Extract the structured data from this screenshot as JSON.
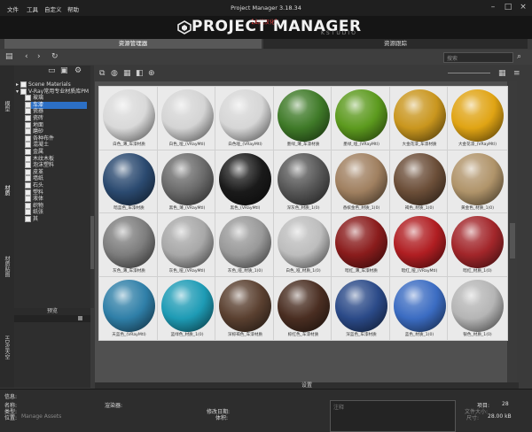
{
  "window": {
    "title": "Project Manager 3.18.34",
    "menu": [
      "文件",
      "工具",
      "自定义",
      "帮助"
    ]
  },
  "banner": {
    "tagline": "【曲线汉化】",
    "logo_text": "PROJECT MANAGER",
    "logo_sub": "KSTUDIO"
  },
  "tabs": [
    "资源管理器",
    "资源跟踪"
  ],
  "search": {
    "placeholder": "搜索"
  },
  "side_tabs": [
    "模型",
    "材质",
    "材质贴图",
    "HDRI天空"
  ],
  "tree": {
    "items": [
      {
        "label": "Scene Materials",
        "indent": 0,
        "expander": "▸",
        "selected": false
      },
      {
        "label": "V-Ray常用专业材质库PM",
        "indent": 0,
        "expander": "▾",
        "selected": false
      },
      {
        "label": "玻璃",
        "indent": 1,
        "expander": "",
        "selected": false
      },
      {
        "label": "车漆",
        "indent": 1,
        "expander": "",
        "selected": true
      },
      {
        "label": "瓷器",
        "indent": 1,
        "expander": "",
        "selected": false
      },
      {
        "label": "瓷砖",
        "indent": 1,
        "expander": "",
        "selected": false
      },
      {
        "label": "地面",
        "indent": 1,
        "expander": "",
        "selected": false
      },
      {
        "label": "磨砂",
        "indent": 1,
        "expander": "",
        "selected": false
      },
      {
        "label": "各种布件",
        "indent": 1,
        "expander": "",
        "selected": false
      },
      {
        "label": "混凝土",
        "indent": 1,
        "expander": "",
        "selected": false
      },
      {
        "label": "金属",
        "indent": 1,
        "expander": "",
        "selected": false
      },
      {
        "label": "木纹木板",
        "indent": 1,
        "expander": "",
        "selected": false
      },
      {
        "label": "泡沫塑料",
        "indent": 1,
        "expander": "",
        "selected": false
      },
      {
        "label": "皮革",
        "indent": 1,
        "expander": "",
        "selected": false
      },
      {
        "label": "墙纸",
        "indent": 1,
        "expander": "",
        "selected": false
      },
      {
        "label": "石头",
        "indent": 1,
        "expander": "",
        "selected": false
      },
      {
        "label": "塑料",
        "indent": 1,
        "expander": "",
        "selected": false
      },
      {
        "label": "液体",
        "indent": 1,
        "expander": "",
        "selected": false
      },
      {
        "label": "织物",
        "indent": 1,
        "expander": "",
        "selected": false
      },
      {
        "label": "纸张",
        "indent": 1,
        "expander": "",
        "selected": false
      },
      {
        "label": "其",
        "indent": 1,
        "expander": "",
        "selected": false
      }
    ]
  },
  "preview": {
    "label": "预览"
  },
  "materials": [
    {
      "caption": "白色_薄_车漆材质",
      "color": "#d9d9d9"
    },
    {
      "caption": "白色_哑_(VRayMtl)",
      "color": "#d4d4d4"
    },
    {
      "caption": "白色哑_(VRayMtl)",
      "color": "#d6d6d6"
    },
    {
      "caption": "墨绿_薄_车漆材质",
      "color": "#3f7a28"
    },
    {
      "caption": "墨绿_哑_(VRayMtl)",
      "color": "#5c9a1e"
    },
    {
      "caption": "大金花漆_车漆材质",
      "color": "#c9961e"
    },
    {
      "caption": "大金花漆_(VRayMtl)",
      "color": "#e0a414"
    },
    {
      "caption": "暗蓝色_车漆材质",
      "color": "#2b4a70"
    },
    {
      "caption": "黑色_薄_(VRayMtl)",
      "color": "#6a6a6a"
    },
    {
      "caption": "黑色_(VRayMtl)",
      "color": "#1a1a1a"
    },
    {
      "caption": "深灰色_材质_1(0)",
      "color": "#565656"
    },
    {
      "caption": "香槟金色_材质_1(0)",
      "color": "#a08060"
    },
    {
      "caption": "褐色_材质_1(0)",
      "color": "#6b4e38"
    },
    {
      "caption": "黄金色_材质_1(0)",
      "color": "#b0946a"
    },
    {
      "caption": "灰色_薄_车漆材质",
      "color": "#7d7d7d"
    },
    {
      "caption": "灰色_哑_(VRayMtl)",
      "color": "#a8a8a8"
    },
    {
      "caption": "灰色_哑_材质_1(0)",
      "color": "#999999"
    },
    {
      "caption": "白色_哑_材质_1(0)",
      "color": "#bdbdbd"
    },
    {
      "caption": "暗红_薄_车漆材质",
      "color": "#8a1c1c"
    },
    {
      "caption": "暗红_哑_(VRayMtl)",
      "color": "#b01e22"
    },
    {
      "caption": "暗红_材质_1(0)",
      "color": "#a2262a"
    },
    {
      "caption": "天蓝色_(VRayMtl)",
      "color": "#2f7fa8"
    },
    {
      "caption": "蓝绿色_材质_1(0)",
      "color": "#1e9bb5"
    },
    {
      "caption": "深棕褐色_车漆材质",
      "color": "#5a4030"
    },
    {
      "caption": "棕红色_车漆材质",
      "color": "#4a2e22"
    },
    {
      "caption": "深蓝色_车漆材质",
      "color": "#2b4a88"
    },
    {
      "caption": "蓝色_材质_1(0)",
      "color": "#3b6cc2"
    },
    {
      "caption": "银色_材质_1(0)",
      "color": "#b5b5b5"
    }
  ],
  "settings": {
    "label": "设置"
  },
  "info": {
    "header": "信息:",
    "name_label": "名称:",
    "type_label": "类型:",
    "path_label": "位置:",
    "path_value": "Manage Assets",
    "renderer_label": "渲染器:",
    "date_label": "修改日期:",
    "size_label": "体积:",
    "note_placeholder": "注释",
    "count_label": "项目:",
    "count_value": "28",
    "dims_label": "文件大小:",
    "total_label": "尺寸:",
    "total_value": "28.00 kB"
  }
}
